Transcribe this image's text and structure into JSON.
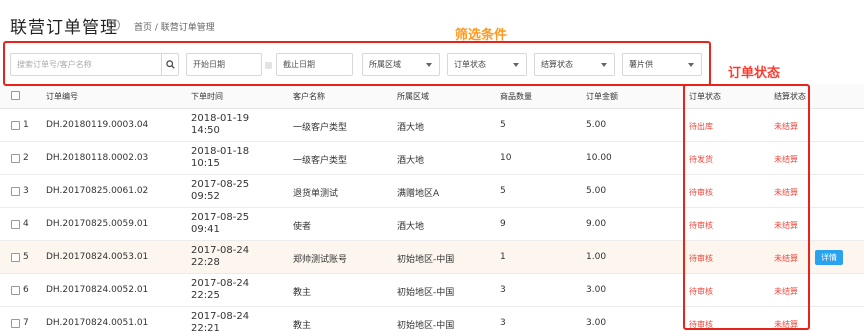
{
  "header": {
    "title": "联营订单管理",
    "help_icon": "help-circle-icon",
    "breadcrumb": "首页 / 联营订单管理"
  },
  "annotations": {
    "filter_label": "筛选条件",
    "status_label": "订单状态",
    "highlight_color": "#e8231c"
  },
  "filters": {
    "search_placeholder": "搜索订单号/客户名称",
    "search_icon": "search-icon",
    "start_date_placeholder": "开始日期",
    "end_date_placeholder": "截止日期",
    "region": "所属区域",
    "order_status": "订单状态",
    "settle_status": "结算状态",
    "shipper": "薯片供"
  },
  "table": {
    "columns": [
      "订单编号",
      "下单时间",
      "客户名称",
      "所属区域",
      "商品数量",
      "订单金额",
      "订单状态",
      "结算状态"
    ],
    "detail_label": "详情",
    "rows": [
      {
        "idx": "1",
        "order_no": "DH.20180119.0003.04",
        "date": "2018-01-19",
        "time": "14:50",
        "customer": "一级客户类型",
        "region": "酒大地",
        "qty": "5",
        "amount": "5.00",
        "status": "待出库",
        "settle": "未结算"
      },
      {
        "idx": "2",
        "order_no": "DH.20180118.0002.03",
        "date": "2018-01-18",
        "time": "10:15",
        "customer": "一级客户类型",
        "region": "酒大地",
        "qty": "10",
        "amount": "10.00",
        "status": "待发货",
        "settle": "未结算"
      },
      {
        "idx": "3",
        "order_no": "DH.20170825.0061.02",
        "date": "2017-08-25",
        "time": "09:52",
        "customer": "退货单测试",
        "region": "满赠地区A",
        "qty": "5",
        "amount": "5.00",
        "status": "待审核",
        "settle": "未结算"
      },
      {
        "idx": "4",
        "order_no": "DH.20170825.0059.01",
        "date": "2017-08-25",
        "time": "09:41",
        "customer": "使者",
        "region": "酒大地",
        "qty": "9",
        "amount": "9.00",
        "status": "待审核",
        "settle": "未结算"
      },
      {
        "idx": "5",
        "order_no": "DH.20170824.0053.01",
        "date": "2017-08-24",
        "time": "22:28",
        "customer": "郑帅测试账号",
        "region": "初始地区-中国",
        "qty": "1",
        "amount": "1.00",
        "status": "待审核",
        "settle": "未结算"
      },
      {
        "idx": "6",
        "order_no": "DH.20170824.0052.01",
        "date": "2017-08-24",
        "time": "22:25",
        "customer": "教主",
        "region": "初始地区-中国",
        "qty": "3",
        "amount": "3.00",
        "status": "待审核",
        "settle": "未结算"
      },
      {
        "idx": "7",
        "order_no": "DH.20170824.0051.01",
        "date": "2017-08-24",
        "time": "22:21",
        "customer": "教主",
        "region": "初始地区-中国",
        "qty": "3",
        "amount": "3.00",
        "status": "待审核",
        "settle": "未结算"
      }
    ]
  },
  "colors": {
    "status_red": "#f0463c",
    "detail_blue": "#29a3ef",
    "annotation_orange": "#ff9a1f",
    "annotation_red": "#ff3b30"
  }
}
